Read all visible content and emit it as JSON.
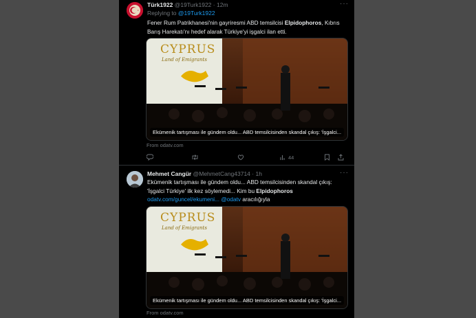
{
  "tweet1": {
    "name": "Türk1922",
    "handle": "@19Turk1922",
    "separator": "·",
    "time": "12m",
    "more": "···",
    "replying_prefix": "Replying to ",
    "replying_handle": "@19Turk1922",
    "text_part1": "Fener Rum Patrikhanesi'nin gayriresmi ABD temsilcisi ",
    "text_bold": "Elpidophoros",
    "text_part2": ", Kıbrıs Barış Harekatı'nı hedef alarak Türkiye'yi işgalci ilan etti.",
    "card_banner_title": "CYPRUS",
    "card_banner_subtitle": "Land of Emigrants",
    "card_caption": "Ekümenik tartışması ile gündem oldu... ABD temsilcisinden skandal çıkış: 'İşgalci...",
    "from": "From odatv.com",
    "actions": {
      "reply_count": "",
      "retweet_count": "",
      "like_count": "",
      "views_count": "44"
    }
  },
  "tweet2": {
    "name": "Mehmet Cangür",
    "handle": "@MehmetCang43714",
    "separator": "·",
    "time": "1h",
    "more": "···",
    "text_part1": "Ekümenik tartışması ile gündem oldu... ABD temsilcisinden skandal çıkış: 'İşgalci Türkiye' ilk kez söylemedi... Kim bu ",
    "text_bold": "Elpidophoros",
    "link": "odatv.com/guncel/ekumeni...",
    "via_handle": "@odatv",
    "via_suffix": " aracılığıyla",
    "card_banner_title": "CYPRUS",
    "card_banner_subtitle": "Land of Emigrants",
    "card_caption": "Ekümenik tartışması ile gündem oldu... ABD temsilcisinden skandal çıkış: 'İşgalci...",
    "from": "From odatv.com"
  },
  "colors": {
    "background": "#4a4a4a",
    "panel": "#000000",
    "text": "#e7e9ea",
    "muted": "#71767b",
    "link": "#1d9bf0"
  }
}
